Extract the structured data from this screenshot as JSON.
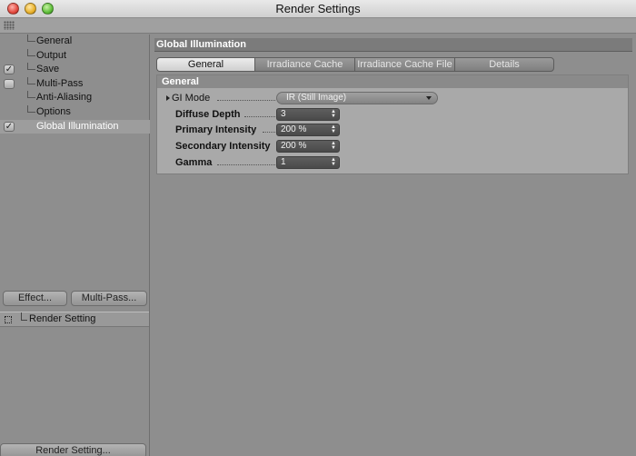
{
  "window": {
    "title": "Render Settings"
  },
  "sidebar": {
    "items": [
      {
        "label": "General",
        "checkbox": "none"
      },
      {
        "label": "Output",
        "checkbox": "none"
      },
      {
        "label": "Save",
        "checkbox": "checked",
        "checkmark": "✓"
      },
      {
        "label": "Multi-Pass",
        "checkbox": "unchecked"
      },
      {
        "label": "Anti-Aliasing",
        "checkbox": "none"
      },
      {
        "label": "Options",
        "checkbox": "none"
      },
      {
        "label": "Global Illumination",
        "checkbox": "checked",
        "checkmark": "✓",
        "selected": true
      }
    ],
    "effect_button": "Effect...",
    "multipass_button": "Multi-Pass...",
    "render_setting_item": "Render Setting",
    "render_setting_button": "Render Setting..."
  },
  "main": {
    "section_title": "Global Illumination",
    "tabs": [
      "General",
      "Irradiance Cache",
      "Irradiance Cache File",
      "Details"
    ],
    "active_tab": "General",
    "group_title": "General",
    "params": {
      "gi_mode": {
        "label": "GI Mode",
        "value": "IR (Still Image)"
      },
      "diffuse_depth": {
        "label": "Diffuse Depth",
        "value": "3"
      },
      "primary_intensity": {
        "label": "Primary Intensity",
        "value": "200 %"
      },
      "secondary_intensity": {
        "label": "Secondary Intensity",
        "value": "200 %"
      },
      "gamma": {
        "label": "Gamma",
        "value": "1"
      }
    }
  },
  "icons": {
    "close": "close-icon",
    "minimize": "minimize-icon",
    "zoom": "zoom-icon",
    "grip": "grip-icon",
    "spinner": "spinner-arrows-icon",
    "dropdown": "chevron-down-icon",
    "expand": "disclosure-triangle-icon"
  },
  "colors": {
    "panel_bg": "#8e8e8e",
    "group_bg": "#a9a9a9",
    "field_bg": "#4e4e4e",
    "active_tab_bg": "#dedede",
    "traffic_red": "#e24a3f",
    "traffic_yellow": "#e9b12b",
    "traffic_green": "#5fbf3a"
  }
}
